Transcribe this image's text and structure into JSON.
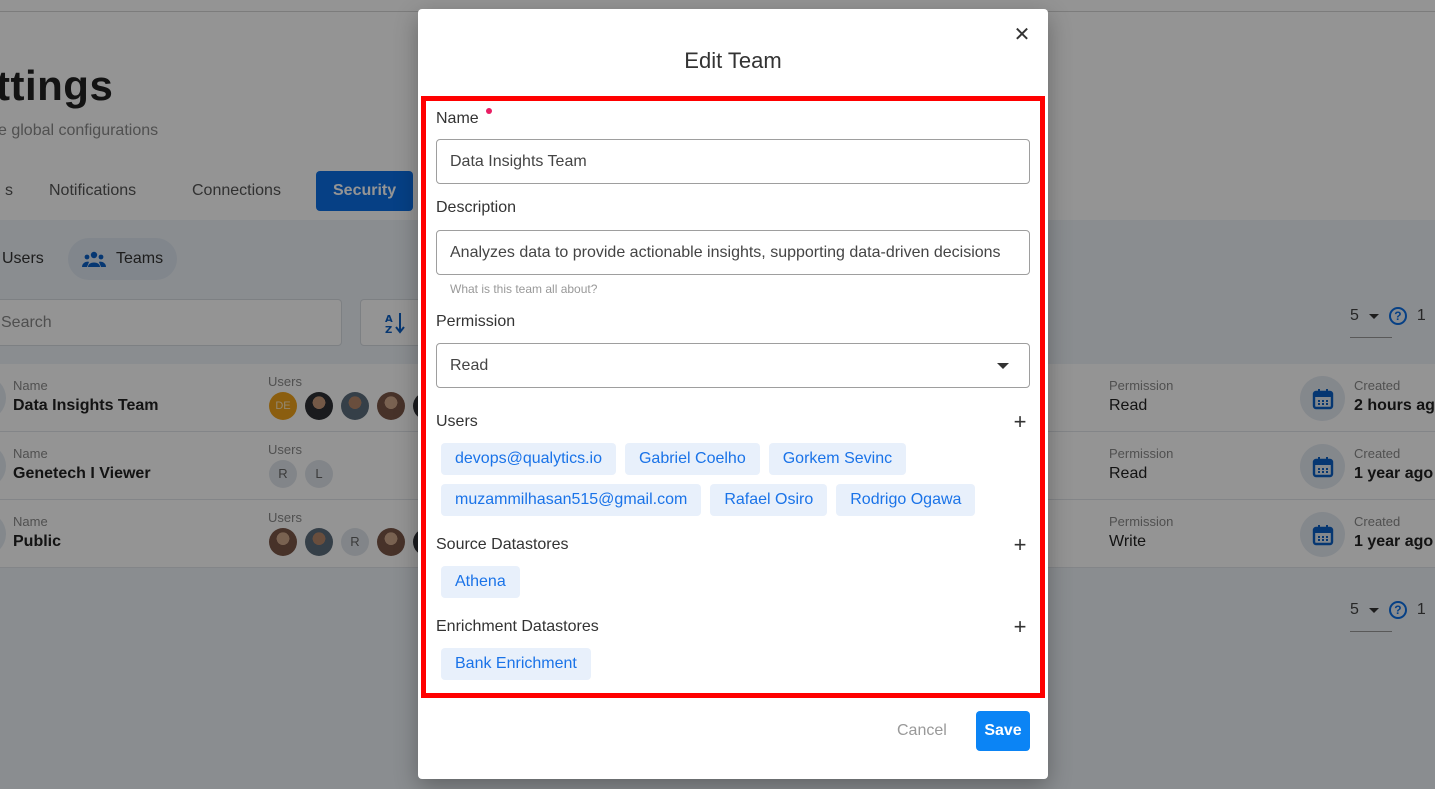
{
  "background": {
    "page_title": "ttings",
    "page_subtitle": "e global configurations",
    "tabs": [
      {
        "label": "s"
      },
      {
        "label": "Notifications"
      },
      {
        "label": "Connections"
      },
      {
        "label": "Security",
        "active": true
      }
    ],
    "subtabs": [
      {
        "label": "Users"
      },
      {
        "label": "Teams",
        "active": true,
        "icon": "group-icon"
      }
    ],
    "search_placeholder": "Search",
    "sort_icon": "sort-alpha-icon",
    "per_page": "5",
    "pagination_text": "1",
    "teams": [
      {
        "name_label": "Name",
        "name": "Data Insights Team",
        "users_label": "Users",
        "users": [
          "DE",
          "photo",
          "photo",
          "photo",
          "photo"
        ],
        "permission_label": "Permission",
        "permission": "Read",
        "created_label": "Created",
        "created": "2 hours ago"
      },
      {
        "name_label": "Name",
        "name": "Genetech I Viewer",
        "users_label": "Users",
        "users": [
          "R",
          "L"
        ],
        "permission_label": "Permission",
        "permission": "Read",
        "created_label": "Created",
        "created": "1 year ago"
      },
      {
        "name_label": "Name",
        "name": "Public",
        "users_label": "Users",
        "users": [
          "photo",
          "photo",
          "R",
          "photo",
          "photo"
        ],
        "permission_label": "Permission",
        "permission": "Write",
        "created_label": "Created",
        "created": "1 year ago"
      }
    ]
  },
  "modal": {
    "title": "Edit Team",
    "close_icon": "close-icon",
    "name": {
      "label": "Name",
      "value": "Data Insights Team",
      "required": true
    },
    "description": {
      "label": "Description",
      "value": "Analyzes data to provide actionable insights, supporting data-driven decisions",
      "helper": "What is this team all about?"
    },
    "permission": {
      "label": "Permission",
      "value": "Read"
    },
    "users": {
      "label": "Users",
      "items": [
        "devops@qualytics.io",
        "Gabriel Coelho",
        "Gorkem Sevinc",
        "muzammilhasan515@gmail.com",
        "Rafael Osiro",
        "Rodrigo Ogawa"
      ]
    },
    "source_datastores": {
      "label": "Source Datastores",
      "items": [
        "Athena"
      ]
    },
    "enrichment_datastores": {
      "label": "Enrichment Datastores",
      "items": [
        "Bank Enrichment"
      ]
    },
    "cancel_label": "Cancel",
    "save_label": "Save",
    "highlight_color": "#ff0000",
    "accent_color": "#0b84f5"
  }
}
